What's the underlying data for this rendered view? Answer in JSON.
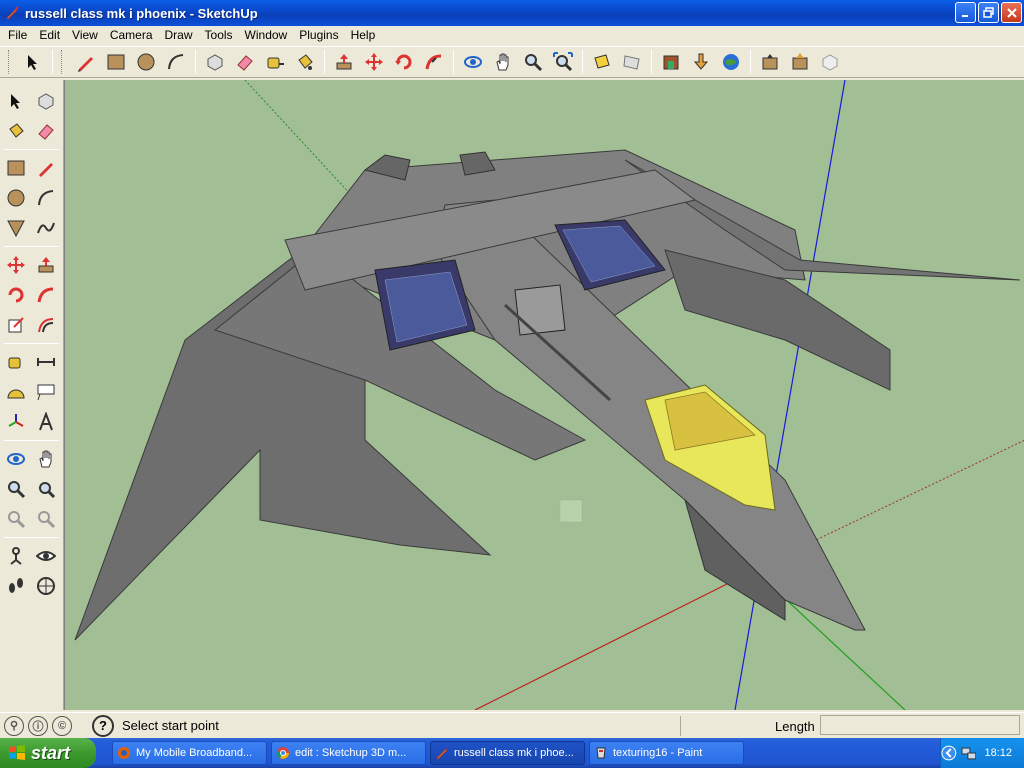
{
  "window": {
    "title": "russell class mk i phoenix - SketchUp"
  },
  "menu": {
    "items": [
      "File",
      "Edit",
      "View",
      "Camera",
      "Draw",
      "Tools",
      "Window",
      "Plugins",
      "Help"
    ]
  },
  "status": {
    "message": "Select start point",
    "vcb_label": "Length",
    "vcb_value": ""
  },
  "taskbar": {
    "start_label": "start",
    "tasks": [
      {
        "label": "My Mobile Broadband..."
      },
      {
        "label": "edit : Sketchup 3D m..."
      },
      {
        "label": "russell class mk i phoe..."
      },
      {
        "label": "texturing16 - Paint"
      }
    ],
    "clock": "18:12"
  },
  "colors": {
    "viewport_bg": "#a1be94",
    "model_gray": "#7a7a7a",
    "glass_yellow": "#e8e65a",
    "axis_red": "#c02020",
    "axis_green": "#20a020",
    "axis_blue": "#1a1adc",
    "titlebar_blue": "#0a4fd8"
  },
  "toolbar_icons": [
    "select-icon",
    "pencil-icon",
    "rectangle-icon",
    "circle-icon",
    "arc-icon",
    "make-component-icon",
    "eraser-icon",
    "tape-measure-icon",
    "paint-bucket-icon",
    "push-pull-icon",
    "move-icon",
    "rotate-icon",
    "follow-me-icon",
    "orbit-icon",
    "pan-icon",
    "zoom-icon",
    "zoom-extents-icon",
    "previous-view-icon",
    "next-view-icon",
    "3d-warehouse-icon",
    "share-model-icon",
    "google-earth-icon",
    "get-models-icon",
    "share-icon",
    "component-icon"
  ]
}
